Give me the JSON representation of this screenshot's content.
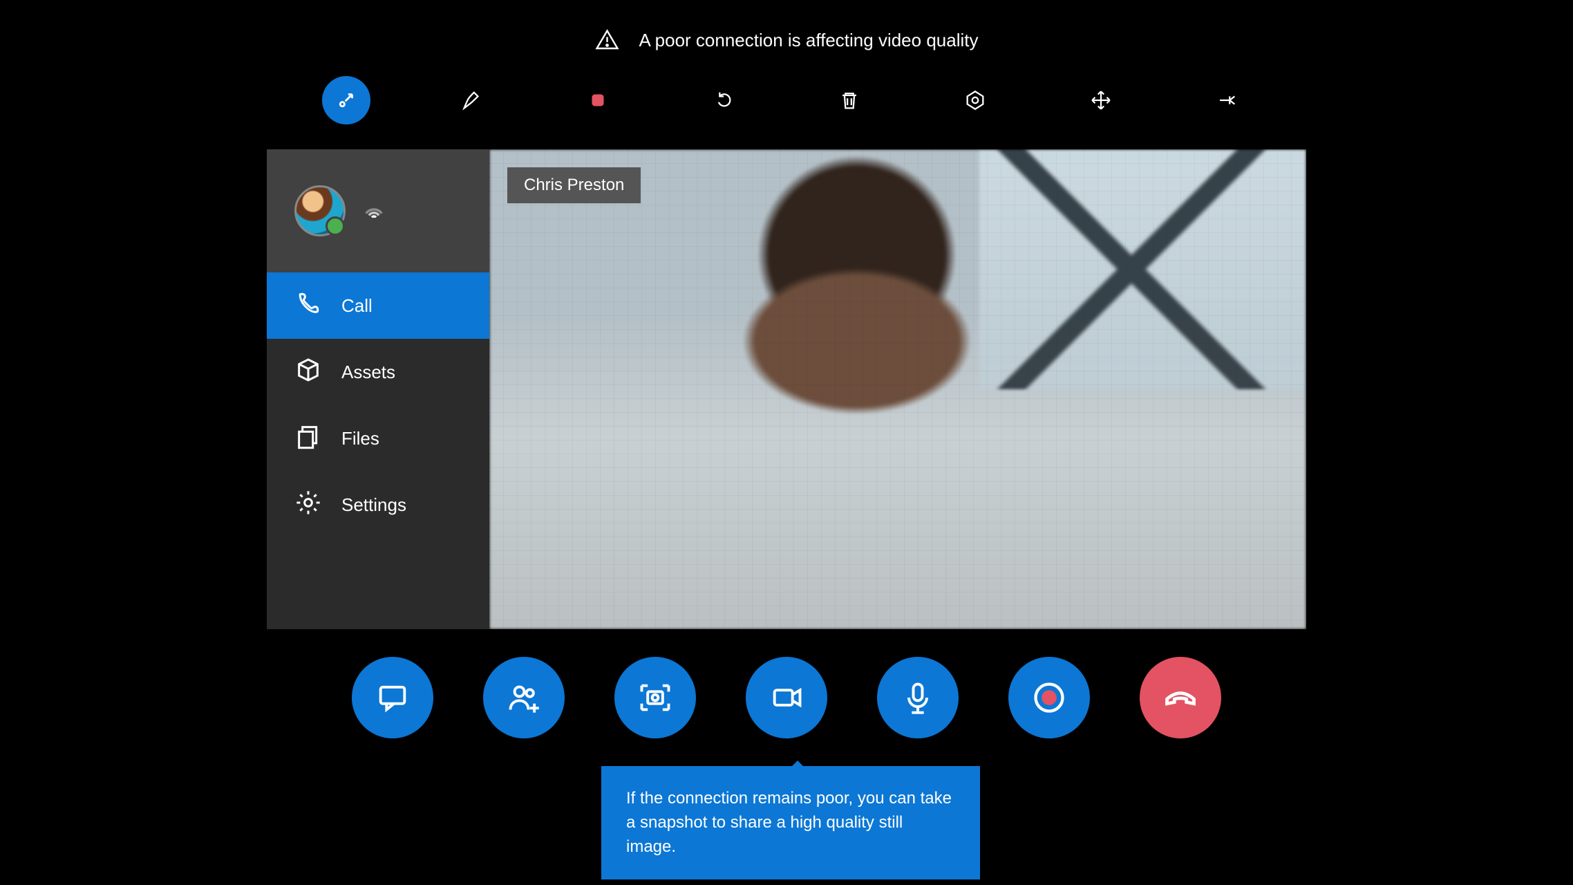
{
  "warning": {
    "message": "A poor connection is affecting video quality"
  },
  "top_toolbar": {
    "items": [
      {
        "name": "pointer",
        "active": true
      },
      {
        "name": "pen"
      },
      {
        "name": "stop-record"
      },
      {
        "name": "undo"
      },
      {
        "name": "delete"
      },
      {
        "name": "reticle"
      },
      {
        "name": "move"
      },
      {
        "name": "pin"
      }
    ]
  },
  "sidebar": {
    "items": [
      {
        "name": "call",
        "label": "Call",
        "active": true
      },
      {
        "name": "assets",
        "label": "Assets"
      },
      {
        "name": "files",
        "label": "Files"
      },
      {
        "name": "settings",
        "label": "Settings"
      }
    ]
  },
  "video": {
    "participant_name": "Chris Preston"
  },
  "actions": {
    "items": [
      {
        "name": "chat"
      },
      {
        "name": "add-participant"
      },
      {
        "name": "snapshot"
      },
      {
        "name": "camera"
      },
      {
        "name": "microphone"
      },
      {
        "name": "record"
      },
      {
        "name": "hang-up"
      }
    ]
  },
  "tooltip": {
    "text": "If the connection remains poor, you can take a snapshot to share a high quality still image."
  },
  "colors": {
    "accent": "#0c77d5",
    "danger": "#e35363"
  }
}
